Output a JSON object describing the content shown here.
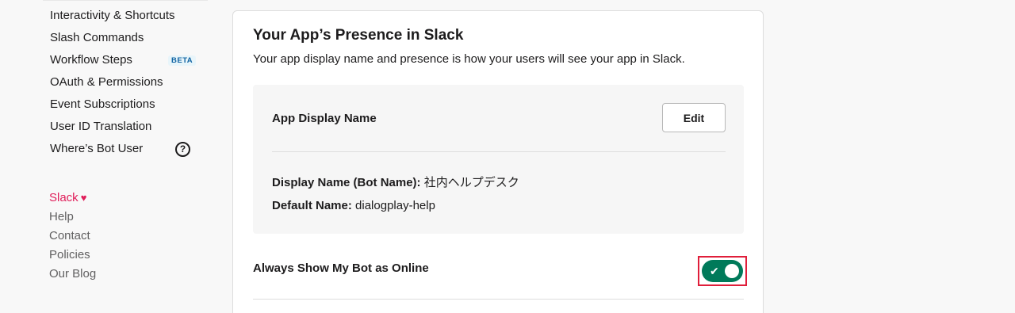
{
  "sidebar": {
    "items": [
      {
        "label": "Interactivity & Shortcuts"
      },
      {
        "label": "Slash Commands"
      },
      {
        "label": "Workflow Steps",
        "badge": "BETA"
      },
      {
        "label": "OAuth & Permissions"
      },
      {
        "label": "Event Subscriptions"
      },
      {
        "label": "User ID Translation"
      },
      {
        "label": "Where’s Bot User",
        "help_icon": "?"
      }
    ],
    "footer": [
      {
        "label": "Slack",
        "icon": "heart-icon"
      },
      {
        "label": "Help"
      },
      {
        "label": "Contact"
      },
      {
        "label": "Policies"
      },
      {
        "label": "Our Blog"
      }
    ]
  },
  "card": {
    "title": "Your App’s Presence in Slack",
    "description": "Your app display name and presence is how your users will see your app in Slack.",
    "display_name_section": {
      "label": "App Display Name",
      "edit_label": "Edit",
      "display_name_key": "Display Name (Bot Name):",
      "display_name_value": "社内ヘルプデスク",
      "default_name_key": "Default Name:",
      "default_name_value": "dialogplay-help"
    },
    "online_toggle": {
      "label": "Always Show My Bot as Online",
      "checked": true,
      "check_glyph": "✔"
    }
  },
  "colors": {
    "accent_slack": "#e01e5a",
    "toggle_on": "#007a5a",
    "highlight_box": "#e01e3a",
    "beta_badge": "#1264a3"
  }
}
